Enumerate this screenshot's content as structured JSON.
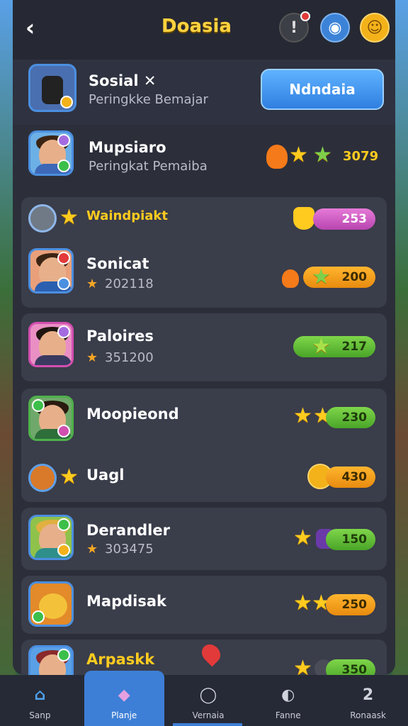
{
  "header": {
    "title": "Doasia",
    "back_icon": "chevron-left-icon",
    "icons": [
      "info-icon",
      "globe-icon",
      "coin-icon"
    ]
  },
  "top_card": {
    "name": "Sosial ✕",
    "subtitle": "Peringkke Bemajar",
    "button": "Ndndaia"
  },
  "rows": [
    {
      "name": "Mupsiaro",
      "sub": "Peringkat Pemaiba",
      "value": "3079"
    },
    {
      "name": "Waindpiakt",
      "sub": "",
      "value": "253"
    },
    {
      "name": "Sonicat",
      "sub": "202118",
      "value": "200"
    },
    {
      "name": "Paloires",
      "sub": "351200",
      "value": "217"
    },
    {
      "name": "Moopieond",
      "sub": "",
      "value": "230"
    },
    {
      "name": "Uagl",
      "sub": "",
      "value": "430"
    },
    {
      "name": "Derandler",
      "sub": "303475",
      "value": "150"
    },
    {
      "name": "Mapdisak",
      "sub": "",
      "value": "250"
    },
    {
      "name": "Arpaskk",
      "sub": "",
      "value": "350"
    }
  ],
  "tabs": [
    {
      "label": "Sanp",
      "icon": "home-icon"
    },
    {
      "label": "Planje",
      "icon": "gem-icon"
    },
    {
      "label": "Vernaia",
      "icon": "chat-icon"
    },
    {
      "label": "Fanne",
      "icon": "shield-icon"
    },
    {
      "label": "Ronaask",
      "icon": "profile-icon"
    }
  ]
}
